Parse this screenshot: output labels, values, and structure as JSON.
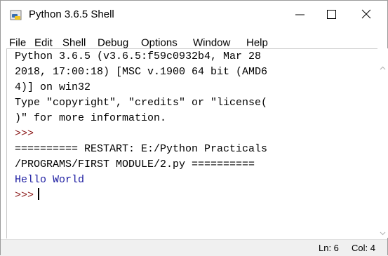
{
  "window": {
    "title": "Python 3.6.5 Shell"
  },
  "menu": {
    "items": [
      "File",
      "Edit",
      "Shell",
      "Debug",
      "Options",
      "Window",
      "Help"
    ]
  },
  "shell": {
    "lines": [
      "Python 3.6.5 (v3.6.5:f59c0932b4, Mar 28",
      "2018, 17:00:18) [MSC v.1900 64 bit (AMD6",
      "4)] on win32",
      "Type \"copyright\", \"credits\" or \"license(",
      ")\" for more information.",
      ">>>",
      "========== RESTART: E:/Python Practicals",
      "/PROGRAMS/FIRST MODULE/2.py ==========",
      "Hello World",
      ">>>"
    ]
  },
  "status": {
    "line": "Ln: 6",
    "col": "Col: 4"
  },
  "colors": {
    "prompt": "#8b1a1a",
    "output": "#1a1aa0"
  }
}
